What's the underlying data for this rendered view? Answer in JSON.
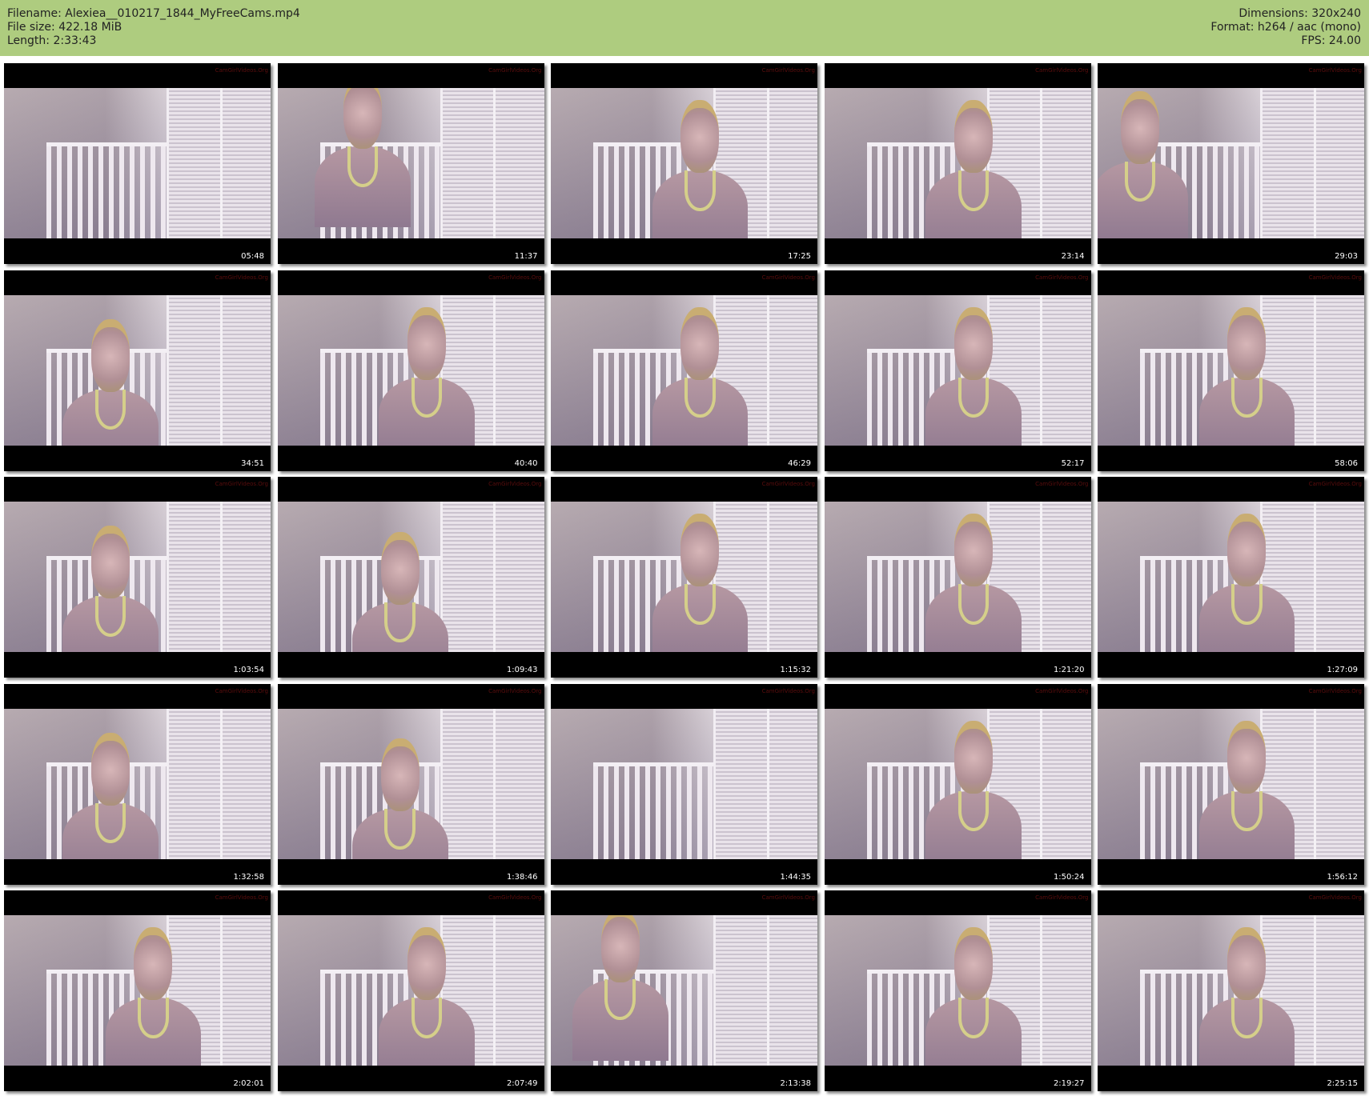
{
  "header": {
    "filename": "Filename: Alexiea__010217_1844_MyFreeCams.mp4",
    "filesize": "File size: 422.18 MiB",
    "length": "Length: 2:33:43",
    "dimensions": "Dimensions: 320x240",
    "format": "Format: h264 / aac (mono)",
    "fps": "FPS: 24.00"
  },
  "thumbnails": [
    {
      "timestamp": "05:48",
      "scene": "empty-room"
    },
    {
      "timestamp": "11:37",
      "scene": "person-leaning"
    },
    {
      "timestamp": "17:25",
      "scene": "person-center"
    },
    {
      "timestamp": "23:14",
      "scene": "person-center"
    },
    {
      "timestamp": "29:03",
      "scene": "person-left-close"
    },
    {
      "timestamp": "34:51",
      "scene": "person-left"
    },
    {
      "timestamp": "40:40",
      "scene": "person-center"
    },
    {
      "timestamp": "46:29",
      "scene": "person-center"
    },
    {
      "timestamp": "52:17",
      "scene": "person-center"
    },
    {
      "timestamp": "58:06",
      "scene": "person-center"
    },
    {
      "timestamp": "1:03:54",
      "scene": "person-left"
    },
    {
      "timestamp": "1:09:43",
      "scene": "person-looking-down"
    },
    {
      "timestamp": "1:15:32",
      "scene": "person-center"
    },
    {
      "timestamp": "1:21:20",
      "scene": "person-center"
    },
    {
      "timestamp": "1:27:09",
      "scene": "person-center"
    },
    {
      "timestamp": "1:32:58",
      "scene": "person-left"
    },
    {
      "timestamp": "1:38:46",
      "scene": "person-looking-down"
    },
    {
      "timestamp": "1:44:35",
      "scene": "empty-room"
    },
    {
      "timestamp": "1:50:24",
      "scene": "person-center"
    },
    {
      "timestamp": "1:56:12",
      "scene": "person-center"
    },
    {
      "timestamp": "2:02:01",
      "scene": "person-center"
    },
    {
      "timestamp": "2:07:49",
      "scene": "person-center"
    },
    {
      "timestamp": "2:13:38",
      "scene": "person-close"
    },
    {
      "timestamp": "2:19:27",
      "scene": "person-center"
    },
    {
      "timestamp": "2:25:15",
      "scene": "person-center"
    }
  ],
  "watermark": "CamGirlVideos.Org",
  "colors": {
    "header_bg": "#aecc7f",
    "thumb_bg": "#000000",
    "timestamp": "#ffffff",
    "watermark": "#5a0d0d"
  }
}
